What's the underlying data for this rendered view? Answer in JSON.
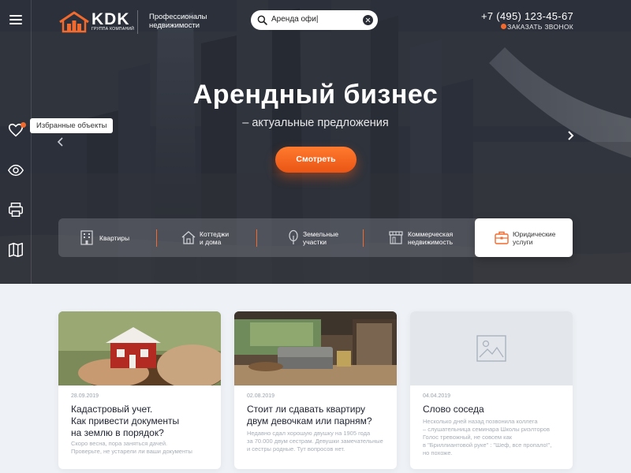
{
  "header": {
    "logo_text": "KDK",
    "logo_sub": "ГРУППА КОМПАНИЙ",
    "tagline": "Профессионалы недвижимости",
    "search": {
      "value": "Аренда офи|"
    },
    "phone": "+7 (495) 123-45-67",
    "callback_label": "ЗАКАЗАТЬ ЗВОНОК"
  },
  "sidebar": {
    "favorites_tooltip": "Избранные объекты"
  },
  "hero": {
    "title": "Арендный бизнес",
    "subtitle": "– актуальные предложения",
    "cta_label": "Смотреть"
  },
  "categories": [
    {
      "label": "Квартиры",
      "icon": "building-icon",
      "active": false
    },
    {
      "label": "Коттеджи\nи дома",
      "icon": "house-icon",
      "active": false
    },
    {
      "label": "Земельные\nучастки",
      "icon": "tree-icon",
      "active": false
    },
    {
      "label": "Коммерческая\nнедвижимость",
      "icon": "shop-icon",
      "active": false
    },
    {
      "label": "Юридические\nуслуги",
      "icon": "briefcase-icon",
      "active": true
    }
  ],
  "news": [
    {
      "date": "28.09.2019",
      "title": "Кадастровый учет.\nКак привести документы\nна землю в порядок?",
      "excerpt": "Скоро весна, пора заняться дачей.\nПроверьте, не устарели ли ваши документы"
    },
    {
      "date": "02.08.2019",
      "title": "Стоит ли сдавать квартиру\nдвум девочкам или парням?",
      "excerpt": "Недавно сдал хорошую двушку на 1905 года\nза 70.000 двум сестрам. Девушки замечательные\nи сестры родные. Тут вопросов нет."
    },
    {
      "date": "04.04.2019",
      "title": "Слово соседа",
      "excerpt": "Несколько дней назад позвонила коллега\n– слушательница семинара Школы риэлторов\nГолос тревожный, не совсем как\nв \"Бриллиантовой руке\" : \"Шеф, все пропало!\",\nно похоже."
    }
  ],
  "colors": {
    "accent": "#f26a2e",
    "hero_dark": "#2b2f38",
    "page_bg": "#eef1f5"
  }
}
